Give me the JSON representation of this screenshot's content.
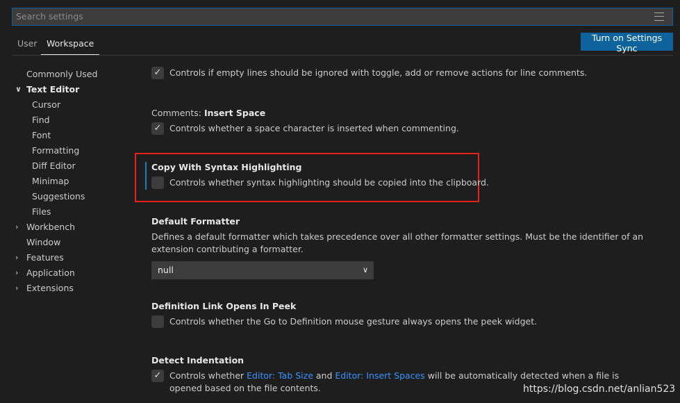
{
  "search": {
    "placeholder": "Search settings"
  },
  "tabs": [
    {
      "label": "User"
    },
    {
      "label": "Workspace"
    }
  ],
  "sync_button": "Turn on Settings Sync",
  "sidebar": [
    {
      "label": "Commonly Used"
    },
    {
      "label": "Text Editor",
      "expanded": true
    },
    {
      "label": "Cursor"
    },
    {
      "label": "Find"
    },
    {
      "label": "Font"
    },
    {
      "label": "Formatting"
    },
    {
      "label": "Diff Editor"
    },
    {
      "label": "Minimap"
    },
    {
      "label": "Suggestions"
    },
    {
      "label": "Files"
    },
    {
      "label": "Workbench",
      "expanded": false
    },
    {
      "label": "Window"
    },
    {
      "label": "Features",
      "expanded": false
    },
    {
      "label": "Application",
      "expanded": false
    },
    {
      "label": "Extensions",
      "expanded": false
    }
  ],
  "settings": {
    "ignore_empty": {
      "desc": "Controls if empty lines should be ignored with toggle, add or remove actions for line comments.",
      "checked": true
    },
    "insert_space": {
      "prefix": "Comments: ",
      "title": "Insert Space",
      "desc": "Controls whether a space character is inserted when commenting.",
      "checked": true
    },
    "copy_syntax": {
      "title": "Copy With Syntax Highlighting",
      "desc": "Controls whether syntax highlighting should be copied into the clipboard.",
      "checked": false
    },
    "default_formatter": {
      "title": "Default Formatter",
      "desc": "Defines a default formatter which takes precedence over all other formatter settings. Must be the identifier of an extension contributing a formatter.",
      "value": "null"
    },
    "definition_peek": {
      "title": "Definition Link Opens In Peek",
      "desc": "Controls whether the Go to Definition mouse gesture always opens the peek widget.",
      "checked": false
    },
    "detect_indent": {
      "title": "Detect Indentation",
      "desc_1": "Controls whether ",
      "link_1": "Editor: Tab Size",
      "desc_2": " and ",
      "link_2": "Editor: Insert Spaces",
      "desc_3": " will be automatically detected when a file is opened based on the file contents.",
      "checked": true
    }
  },
  "watermark": "https://blog.csdn.net/anlian523",
  "colors": {
    "accent": "#0e639c",
    "highlight_border": "#e8231b",
    "link": "#3794ff"
  }
}
